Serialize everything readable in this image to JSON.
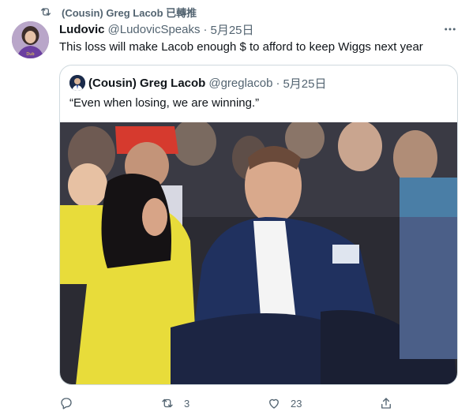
{
  "retweet_banner": {
    "text": "(Cousin) Greg Lacob 已轉推",
    "icon": "retweet-icon"
  },
  "tweet": {
    "author_name": "Ludovic",
    "author_handle": "@LudovicSpeaks",
    "separator": "·",
    "date": "5月25日",
    "text": "This loss will make Lacob enough $ to afford to keep Wiggs next year",
    "more_icon": "more-icon"
  },
  "quote": {
    "author_name": "(Cousin) Greg Lacob",
    "author_handle": "@greglacob",
    "separator": "·",
    "date": "5月25日",
    "text": "“Even when losing, we are winning.”"
  },
  "actions": {
    "reply_count": "",
    "retweet_count": "3",
    "like_count": "23"
  },
  "colors": {
    "text_primary": "#0f1419",
    "text_secondary": "#536471",
    "border": "#cfd9de",
    "sleeve": "#e8dc3a"
  }
}
